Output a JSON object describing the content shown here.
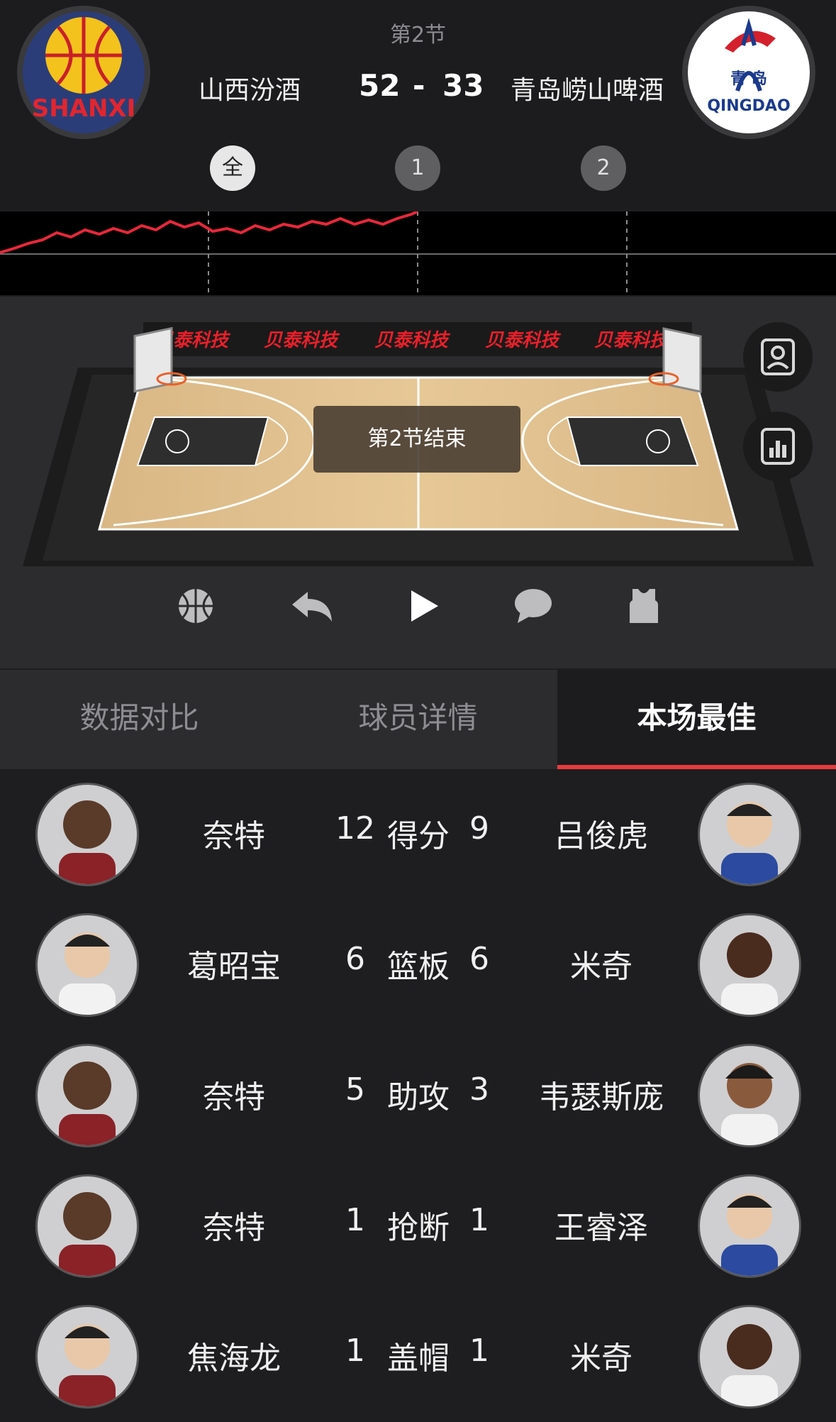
{
  "header": {
    "period": "第2节",
    "home_team": "山西汾酒",
    "away_team": "青岛崂山啤酒",
    "home_score": "52",
    "dash": "-",
    "away_score": "33",
    "home_logo_text": "SHANXI",
    "away_logo_text": "QINGDAO",
    "away_logo_chars": "青 岛",
    "quarter_tabs": [
      "全",
      "1",
      "2"
    ],
    "active_quarter": "全"
  },
  "court": {
    "sponsor_banner": [
      "贝泰科技",
      "贝泰科技",
      "贝泰科技",
      "贝泰科技",
      "贝泰科技"
    ],
    "status_overlay": "第2节结束",
    "side_buttons": [
      "player-card-icon",
      "stats-report-icon"
    ],
    "controls": [
      "basketball-icon",
      "replay-icon",
      "play-icon",
      "comment-icon",
      "jersey-icon"
    ]
  },
  "tabs": [
    "数据对比",
    "球员详情",
    "本场最佳"
  ],
  "active_tab": "本场最佳",
  "leaders": [
    {
      "stat": "得分",
      "home_player": "奈特",
      "home_value": "12",
      "away_value": "9",
      "away_player": "吕俊虎"
    },
    {
      "stat": "篮板",
      "home_player": "葛昭宝",
      "home_value": "6",
      "away_value": "6",
      "away_player": "米奇"
    },
    {
      "stat": "助攻",
      "home_player": "奈特",
      "home_value": "5",
      "away_value": "3",
      "away_player": "韦瑟斯庞"
    },
    {
      "stat": "抢断",
      "home_player": "奈特",
      "home_value": "1",
      "away_value": "1",
      "away_player": "王睿泽"
    },
    {
      "stat": "盖帽",
      "home_player": "焦海龙",
      "home_value": "1",
      "away_value": "1",
      "away_player": "米奇"
    }
  ],
  "colors": {
    "accent_red": "#e93a3d",
    "trend_line": "#e8283a",
    "home_logo_bg": "#2b3d78",
    "away_logo_bg": "#ffffff"
  }
}
